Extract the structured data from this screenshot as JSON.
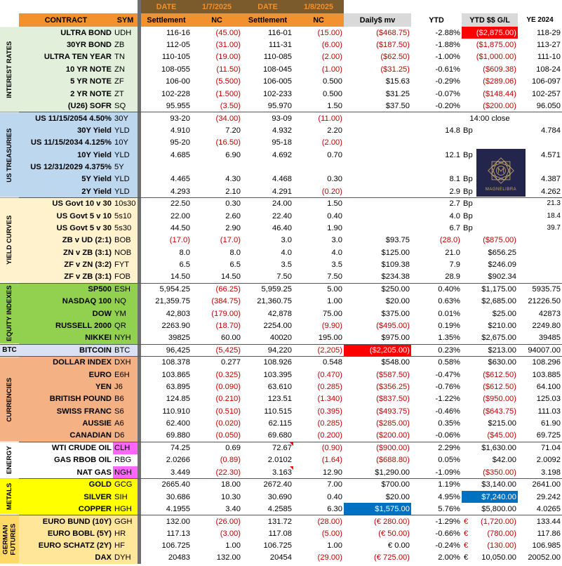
{
  "header": {
    "date_label_1": "DATE",
    "date_1": "1/7/2025",
    "date_label_2": "DATE",
    "date_2": "1/8/2025",
    "contract": "CONTRACT",
    "sym": "SYM",
    "settlement_1": "Settlement",
    "nc_1": "NC",
    "settlement_2": "Settlement",
    "nc_2": "NC",
    "daily_mv": "Daily$ mv",
    "ytd": "YTD",
    "ytd_gl": "YTD $$ G/L",
    "ye": "YE 2024"
  },
  "sections": {
    "interest_rates": "INTEREST RATES",
    "us_treasuries": "US TREASURIES",
    "yield_curves": "YIELD CURVES",
    "equity": "EQUITY INDEXES",
    "btc": "BTC",
    "currencies": "CURRENCIES",
    "energy": "ENERGY",
    "metals": "METALS",
    "german": "GERMAN FUTURES"
  },
  "logo": {
    "text": "MAGNELIBRA"
  },
  "rows": [
    {
      "n": "ULTRA BOND",
      "s": "UDH",
      "s1": "116-16",
      "nc1": "(45.00)",
      "s2": "116-01",
      "nc2": "(15.00)",
      "mv": "($468.75)",
      "ytd": "-2.88%",
      "gl": "($2,875.00)",
      "ye": "118-29"
    },
    {
      "n": "30YR BOND",
      "s": "ZB",
      "s1": "112-05",
      "nc1": "(31.00)",
      "s2": "111-31",
      "nc2": "(6.00)",
      "mv": "($187.50)",
      "ytd": "-1.88%",
      "gl": "($1,875.00)",
      "ye": "113-27"
    },
    {
      "n": "ULTRA TEN YEAR",
      "s": "TN",
      "s1": "110-105",
      "nc1": "(19.00)",
      "s2": "110-085",
      "nc2": "(2.00)",
      "mv": "($62.50)",
      "ytd": "-1.00%",
      "gl": "($1,000.00)",
      "ye": "111-10"
    },
    {
      "n": "10 YR NOTE",
      "s": "ZN",
      "s1": "108-055",
      "nc1": "(11.50)",
      "s2": "108-045",
      "nc2": "(1.00)",
      "mv": "($31.25)",
      "ytd": "-0.61%",
      "gl": "($609.38)",
      "ye": "108-24"
    },
    {
      "n": "5 YR NOTE",
      "s": "ZF",
      "s1": "106-00",
      "nc1": "(5.500)",
      "s2": "106-005",
      "nc2": "0.500",
      "mv": "$15.63",
      "ytd": "-0.29%",
      "gl": "($289.06)",
      "ye": "106-097"
    },
    {
      "n": "2 YR NOTE",
      "s": "ZT",
      "s1": "102-228",
      "nc1": "(1.500)",
      "s2": "102-233",
      "nc2": "0.500",
      "mv": "$31.25",
      "ytd": "-0.07%",
      "gl": "($148.44)",
      "ye": "102-257"
    },
    {
      "n": "(U26) SOFR",
      "s": "SQ",
      "s1": "95.955",
      "nc1": "(3.50)",
      "s2": "95.970",
      "nc2": "1.50",
      "mv": "$37.50",
      "ytd": "-0.20%",
      "gl": "($200.00)",
      "ye": "96.050"
    },
    {
      "n": "US 11/15/2054 4.50%",
      "s": "30Y",
      "s1": "93-20",
      "nc1": "(34.00)",
      "s2": "93-09",
      "nc2": "(11.00)",
      "mv": "",
      "ytd": "",
      "gl": "14:00 close",
      "ye": ""
    },
    {
      "n": "30Y Yield",
      "s": "YLD",
      "s1": "4.910",
      "nc1": "7.20",
      "s2": "4.932",
      "nc2": "2.20",
      "mv": "",
      "ytd": "14.8",
      "bp": "Bp",
      "gl": "",
      "ye": "4.784"
    },
    {
      "n": "US 11/15/2034 4.125%",
      "s": "10Y",
      "s1": "95-20",
      "nc1": "(16.50)",
      "s2": "95-18",
      "nc2": "(2.00)",
      "mv": "",
      "ytd": "",
      "gl": "",
      "ye": ""
    },
    {
      "n": "10Y Yield",
      "s": "YLD",
      "s1": "4.685",
      "nc1": "6.90",
      "s2": "4.692",
      "nc2": "0.70",
      "mv": "",
      "ytd": "12.1",
      "bp": "Bp",
      "gl": "",
      "ye": "4.571"
    },
    {
      "n": "US 12/31/2029 4.375%",
      "s": "5Y",
      "s1": "",
      "nc1": "",
      "s2": "",
      "nc2": "",
      "mv": "",
      "ytd": "",
      "gl": "",
      "ye": ""
    },
    {
      "n": "5Y Yield",
      "s": "YLD",
      "s1": "4.465",
      "nc1": "4.30",
      "s2": "4.468",
      "nc2": "0.30",
      "mv": "",
      "ytd": "8.1",
      "bp": "Bp",
      "gl": "",
      "ye": "4.387"
    },
    {
      "n": "2Y Yield",
      "s": "YLD",
      "s1": "4.293",
      "nc1": "2.10",
      "s2": "4.291",
      "nc2": "(0.20)",
      "mv": "",
      "ytd": "2.9",
      "bp": "Bp",
      "gl": "",
      "ye": "4.262"
    },
    {
      "n": "US Govt 10 v 30",
      "s": "10s30",
      "s1": "22.50",
      "nc1": "0.30",
      "s2": "24.00",
      "nc2": "1.50",
      "mv": "",
      "ytd": "2.7",
      "bp": "Bp",
      "gl": "",
      "ye": "21.3"
    },
    {
      "n": "US Govt 5 v 10",
      "s": "5s10",
      "s1": "22.00",
      "nc1": "2.60",
      "s2": "22.40",
      "nc2": "0.40",
      "mv": "",
      "ytd": "4.0",
      "bp": "Bp",
      "gl": "",
      "ye": "18.4"
    },
    {
      "n": "US Govt 5 v 30",
      "s": "5s30",
      "s1": "44.50",
      "nc1": "2.90",
      "s2": "46.40",
      "nc2": "1.90",
      "mv": "",
      "ytd": "6.7",
      "bp": "Bp",
      "gl": "",
      "ye": "39.7"
    },
    {
      "n": "ZB v UD (2:1)",
      "s": "BOB",
      "s1": "(17.0)",
      "nc1": "(17.0)",
      "s2": "3.0",
      "nc2": "3.0",
      "mv": "$93.75",
      "ytd": "(28.0)",
      "gl": "($875.00)",
      "ye": ""
    },
    {
      "n": "ZN v ZB (3:1)",
      "s": "NOB",
      "s1": "8.0",
      "nc1": "8.0",
      "s2": "4.0",
      "nc2": "4.0",
      "mv": "$125.00",
      "ytd": "21.0",
      "gl": "$656.25",
      "ye": ""
    },
    {
      "n": "ZF v ZN (3:2)",
      "s": "FYT",
      "s1": "6.5",
      "nc1": "6.5",
      "s2": "3.5",
      "nc2": "3.5",
      "mv": "$109.38",
      "ytd": "7.9",
      "gl": "$246.09",
      "ye": ""
    },
    {
      "n": "ZF v ZB (3:1)",
      "s": "FOB",
      "s1": "14.50",
      "nc1": "14.50",
      "s2": "7.50",
      "nc2": "7.50",
      "mv": "$234.38",
      "ytd": "28.9",
      "gl": "$902.34",
      "ye": ""
    },
    {
      "n": "SP500",
      "s": "ESH",
      "s1": "5,954.25",
      "nc1": "(66.25)",
      "s2": "5,959.25",
      "nc2": "5.00",
      "mv": "$250.00",
      "ytd": "0.40%",
      "gl": "$1,175.00",
      "ye": "5935.75"
    },
    {
      "n": "NASDAQ 100",
      "s": "NQ",
      "s1": "21,359.75",
      "nc1": "(384.75)",
      "s2": "21,360.75",
      "nc2": "1.00",
      "mv": "$20.00",
      "ytd": "0.63%",
      "gl": "$2,685.00",
      "ye": "21226.50"
    },
    {
      "n": "DOW",
      "s": "YM",
      "s1": "42,803",
      "nc1": "(179.00)",
      "s2": "42,878",
      "nc2": "75.00",
      "mv": "$375.00",
      "ytd": "0.01%",
      "gl": "$25.00",
      "ye": "42873"
    },
    {
      "n": "RUSSELL 2000",
      "s": "QR",
      "s1": "2263.90",
      "nc1": "(18.70)",
      "s2": "2254.00",
      "nc2": "(9.90)",
      "mv": "($495.00)",
      "ytd": "0.19%",
      "gl": "$210.00",
      "ye": "2249.80"
    },
    {
      "n": "NIKKEI",
      "s": "NYH",
      "s1": "39825",
      "nc1": "60.00",
      "s2": "40020",
      "nc2": "195.00",
      "mv": "$975.00",
      "ytd": "1.35%",
      "gl": "$2,675.00",
      "ye": "39485"
    },
    {
      "n": "BITCOIN",
      "s": "BTC",
      "s1": "96,425",
      "nc1": "(5,425)",
      "s2": "94,220",
      "nc2": "(2,205)",
      "mv": "($2,205.00)",
      "ytd": "0.23%",
      "gl": "$213.00",
      "ye": "94007.00"
    },
    {
      "n": "DOLLAR INDEX",
      "s": "DXH",
      "s1": "108.378",
      "nc1": "0.277",
      "s2": "108.926",
      "nc2": "0.548",
      "mv": "$548.00",
      "ytd": "0.58%",
      "gl": "$630.00",
      "ye": "108.296"
    },
    {
      "n": "EURO",
      "s": "E6H",
      "s1": "103.865",
      "nc1": "(0.325)",
      "s2": "103.395",
      "nc2": "(0.470)",
      "mv": "($587.50)",
      "ytd": "-0.47%",
      "gl": "($612.50)",
      "ye": "103.885"
    },
    {
      "n": "YEN",
      "s": "J6",
      "s1": "63.895",
      "nc1": "(0.090)",
      "s2": "63.610",
      "nc2": "(0.285)",
      "mv": "($356.25)",
      "ytd": "-0.76%",
      "gl": "($612.50)",
      "ye": "64.100"
    },
    {
      "n": "BRITISH POUND",
      "s": "B6",
      "s1": "124.85",
      "nc1": "(0.210)",
      "s2": "123.51",
      "nc2": "(1.340)",
      "mv": "($837.50)",
      "ytd": "-1.22%",
      "gl": "($950.00)",
      "ye": "125.03"
    },
    {
      "n": "SWISS FRANC",
      "s": "S6",
      "s1": "110.910",
      "nc1": "(0.510)",
      "s2": "110.515",
      "nc2": "(0.395)",
      "mv": "($493.75)",
      "ytd": "-0.46%",
      "gl": "($643.75)",
      "ye": "111.03"
    },
    {
      "n": "AUSSIE",
      "s": "A6",
      "s1": "62.400",
      "nc1": "(0.020)",
      "s2": "62.115",
      "nc2": "(0.285)",
      "mv": "($285.00)",
      "ytd": "0.35%",
      "gl": "$215.00",
      "ye": "61.90"
    },
    {
      "n": "CANADIAN",
      "s": "D6",
      "s1": "69.880",
      "nc1": "(0.050)",
      "s2": "69.680",
      "nc2": "(0.200)",
      "mv": "($200.00)",
      "ytd": "-0.06%",
      "gl": "($45.00)",
      "ye": "69.725"
    },
    {
      "n": "WTI CRUDE OIL",
      "s": "CLH",
      "s1": "74.25",
      "nc1": "0.69",
      "s2": "72.67",
      "nc2": "(0.90)",
      "mv": "($900.00)",
      "ytd": "2.29%",
      "gl": "$1,630.00",
      "ye": "71.04"
    },
    {
      "n": "GAS RBOB OIL",
      "s": "RBG",
      "s1": "2.0266",
      "nc1": "(0.89)",
      "s2": "2.0102",
      "nc2": "(1.64)",
      "mv": "($688.80)",
      "ytd": "0.05%",
      "gl": "$42.00",
      "ye": "2.0092"
    },
    {
      "n": "NAT GAS",
      "s": "NGH",
      "s1": "3.449",
      "nc1": "(22.30)",
      "s2": "3.163",
      "nc2": "12.90",
      "mv": "$1,290.00",
      "ytd": "-1.09%",
      "gl": "($350.00)",
      "ye": "3.198"
    },
    {
      "n": "GOLD",
      "s": "GCG",
      "s1": "2665.40",
      "nc1": "18.00",
      "s2": "2672.40",
      "nc2": "7.00",
      "mv": "$700.00",
      "ytd": "1.19%",
      "gl": "$3,140.00",
      "ye": "2641.00"
    },
    {
      "n": "SILVER",
      "s": "SIH",
      "s1": "30.686",
      "nc1": "10.30",
      "s2": "30.690",
      "nc2": "0.40",
      "mv": "$20.00",
      "ytd": "4.95%",
      "gl": "$7,240.00",
      "ye": "29.242"
    },
    {
      "n": "COPPER",
      "s": "HGH",
      "s1": "4.1955",
      "nc1": "3.40",
      "s2": "4.2585",
      "nc2": "6.30",
      "mv": "$1,575.00",
      "ytd": "5.76%",
      "gl": "$5,800.00",
      "ye": "4.0265"
    },
    {
      "n": "EURO BUND (10Y)",
      "s": "GGH",
      "s1": "132.00",
      "nc1": "(26.00)",
      "s2": "131.72",
      "nc2": "(28.00)",
      "mv": "(€ 280.00)",
      "ytd": "-1.29%",
      "eur": "€",
      "gl": "(1,720.00)",
      "ye": "133.44"
    },
    {
      "n": "EURO BOBL (5Y)",
      "s": "HR",
      "s1": "117.13",
      "nc1": "(3.00)",
      "s2": "117.08",
      "nc2": "(5.00)",
      "mv": "(€ 50.00)",
      "ytd": "-0.66%",
      "eur": "€",
      "gl": "(780.00)",
      "ye": "117.86"
    },
    {
      "n": "EURO SCHATZ (2Y)",
      "s": "HF",
      "s1": "106.725",
      "nc1": "1.00",
      "s2": "106.725",
      "nc2": "1.00",
      "mv": "€ 0.00",
      "ytd": "-0.24%",
      "eur": "€",
      "gl": "(130.00)",
      "ye": "106.985"
    },
    {
      "n": "DAX",
      "s": "DYH",
      "s1": "20483",
      "nc1": "132.00",
      "s2": "20454",
      "nc2": "(29.00)",
      "mv": "(€ 725.00)",
      "ytd": "2.00%",
      "eur": "€",
      "gl": "10,050.00",
      "ye": "20052.00"
    }
  ]
}
